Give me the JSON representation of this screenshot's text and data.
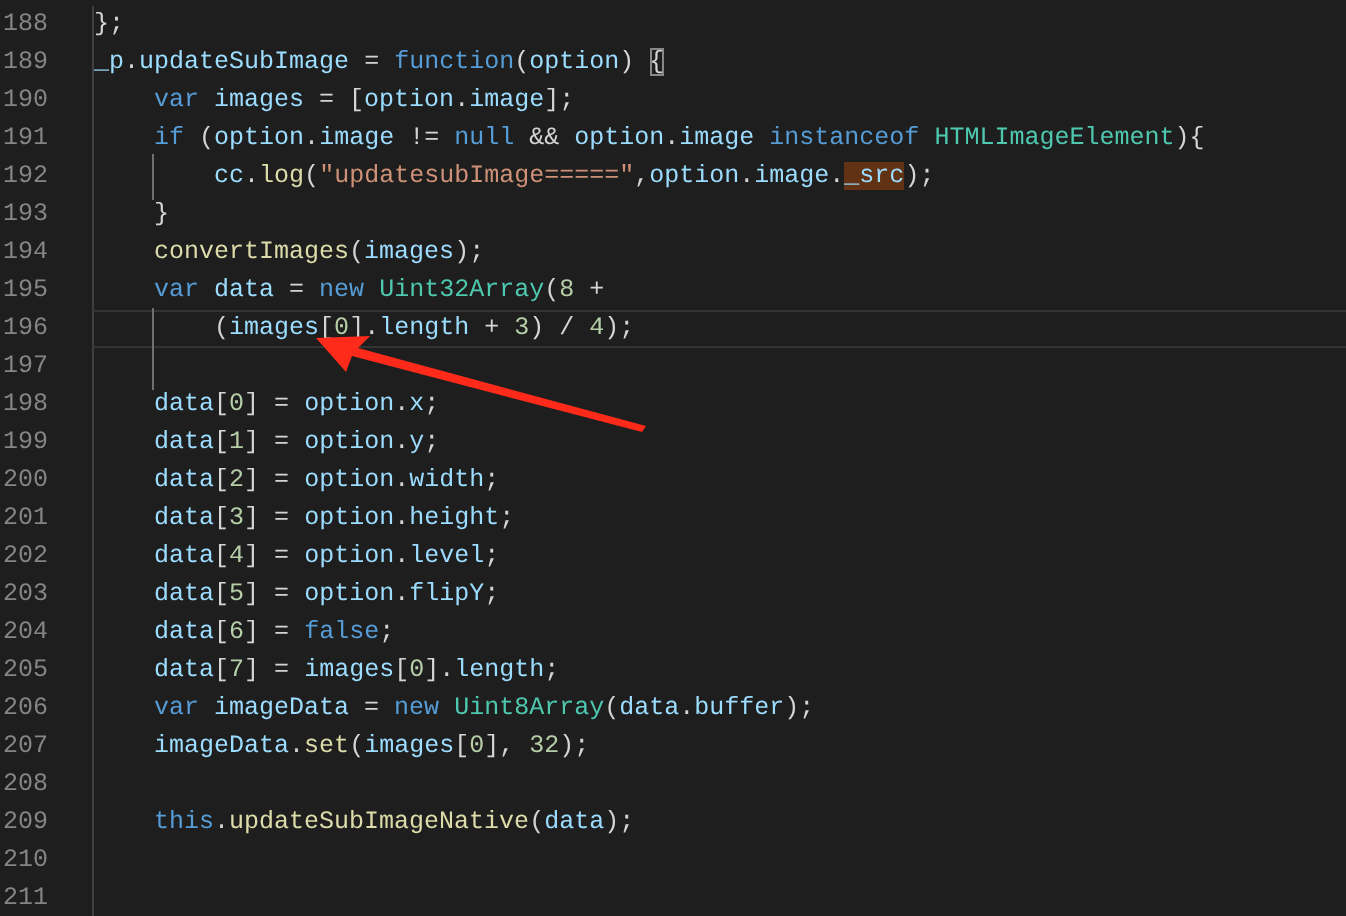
{
  "editor": {
    "lines": [
      {
        "number": "188",
        "current": false,
        "tokens": [
          {
            "text": "};",
            "kind": "punct"
          }
        ]
      },
      {
        "number": "189",
        "current": false,
        "tokens": [
          {
            "text": "_p",
            "kind": "var"
          },
          {
            "text": ".",
            "kind": "punct"
          },
          {
            "text": "updateSubImage",
            "kind": "var"
          },
          {
            "text": " = ",
            "kind": "punct"
          },
          {
            "text": "function",
            "kind": "keyword"
          },
          {
            "text": "(",
            "kind": "punct"
          },
          {
            "text": "option",
            "kind": "var"
          },
          {
            "text": ") ",
            "kind": "punct"
          },
          {
            "text": "{",
            "kind": "matched-bracket"
          }
        ]
      },
      {
        "number": "190",
        "current": false,
        "tokens": [
          {
            "text": "    var ",
            "kind": "keyword"
          },
          {
            "text": "images",
            "kind": "var"
          },
          {
            "text": " = [",
            "kind": "punct"
          },
          {
            "text": "option",
            "kind": "var"
          },
          {
            "text": ".",
            "kind": "punct"
          },
          {
            "text": "image",
            "kind": "var"
          },
          {
            "text": "];",
            "kind": "punct"
          }
        ]
      },
      {
        "number": "191",
        "current": false,
        "tokens": [
          {
            "text": "    if",
            "kind": "keyword"
          },
          {
            "text": " (",
            "kind": "punct"
          },
          {
            "text": "option",
            "kind": "var"
          },
          {
            "text": ".",
            "kind": "punct"
          },
          {
            "text": "image",
            "kind": "var"
          },
          {
            "text": " != ",
            "kind": "punct"
          },
          {
            "text": "null",
            "kind": "keyword"
          },
          {
            "text": " && ",
            "kind": "punct"
          },
          {
            "text": "option",
            "kind": "var"
          },
          {
            "text": ".",
            "kind": "punct"
          },
          {
            "text": "image",
            "kind": "var"
          },
          {
            "text": " instanceof ",
            "kind": "keyword"
          },
          {
            "text": "HTMLImageElement",
            "kind": "type"
          },
          {
            "text": "){",
            "kind": "punct"
          }
        ]
      },
      {
        "number": "192",
        "current": false,
        "tokens": [
          {
            "text": "        cc",
            "kind": "var"
          },
          {
            "text": ".",
            "kind": "punct"
          },
          {
            "text": "log",
            "kind": "function"
          },
          {
            "text": "(",
            "kind": "punct"
          },
          {
            "text": "\"updatesubImage=====\"",
            "kind": "string"
          },
          {
            "text": ",",
            "kind": "punct"
          },
          {
            "text": "option",
            "kind": "var"
          },
          {
            "text": ".",
            "kind": "punct"
          },
          {
            "text": "image",
            "kind": "var"
          },
          {
            "text": ".",
            "kind": "punct"
          },
          {
            "text": "_src",
            "kind": "highlighted-word"
          },
          {
            "text": ");",
            "kind": "punct"
          }
        ]
      },
      {
        "number": "193",
        "current": false,
        "tokens": [
          {
            "text": "    }",
            "kind": "punct"
          }
        ]
      },
      {
        "number": "194",
        "current": false,
        "tokens": [
          {
            "text": "    convertImages",
            "kind": "function"
          },
          {
            "text": "(",
            "kind": "punct"
          },
          {
            "text": "images",
            "kind": "var"
          },
          {
            "text": ");",
            "kind": "punct"
          }
        ]
      },
      {
        "number": "195",
        "current": false,
        "tokens": [
          {
            "text": "    var ",
            "kind": "keyword"
          },
          {
            "text": "data",
            "kind": "var"
          },
          {
            "text": " = ",
            "kind": "punct"
          },
          {
            "text": "new ",
            "kind": "keyword"
          },
          {
            "text": "Uint32Array",
            "kind": "type"
          },
          {
            "text": "(",
            "kind": "punct"
          },
          {
            "text": "8",
            "kind": "number"
          },
          {
            "text": " +",
            "kind": "punct"
          }
        ]
      },
      {
        "number": "196",
        "current": true,
        "tokens": [
          {
            "text": "        (",
            "kind": "punct"
          },
          {
            "text": "images",
            "kind": "var"
          },
          {
            "text": "[",
            "kind": "punct"
          },
          {
            "text": "0",
            "kind": "number"
          },
          {
            "text": "].",
            "kind": "punct"
          },
          {
            "text": "length",
            "kind": "var"
          },
          {
            "text": " + ",
            "kind": "punct"
          },
          {
            "text": "3",
            "kind": "number"
          },
          {
            "text": ") / ",
            "kind": "punct"
          },
          {
            "text": "4",
            "kind": "number"
          },
          {
            "text": ");",
            "kind": "punct"
          }
        ]
      },
      {
        "number": "197",
        "current": false
      },
      {
        "number": "198",
        "current": false,
        "tokens": [
          {
            "text": "    data",
            "kind": "var"
          },
          {
            "text": "[",
            "kind": "punct"
          },
          {
            "text": "0",
            "kind": "number"
          },
          {
            "text": "] = ",
            "kind": "punct"
          },
          {
            "text": "option",
            "kind": "var"
          },
          {
            "text": ".",
            "kind": "punct"
          },
          {
            "text": "x",
            "kind": "var"
          },
          {
            "text": ";",
            "kind": "punct"
          }
        ]
      },
      {
        "number": "199",
        "current": false,
        "tokens": [
          {
            "text": "    data",
            "kind": "var"
          },
          {
            "text": "[",
            "kind": "punct"
          },
          {
            "text": "1",
            "kind": "number"
          },
          {
            "text": "] = ",
            "kind": "punct"
          },
          {
            "text": "option",
            "kind": "var"
          },
          {
            "text": ".",
            "kind": "punct"
          },
          {
            "text": "y",
            "kind": "var"
          },
          {
            "text": ";",
            "kind": "punct"
          }
        ]
      },
      {
        "number": "200",
        "current": false,
        "tokens": [
          {
            "text": "    data",
            "kind": "var"
          },
          {
            "text": "[",
            "kind": "punct"
          },
          {
            "text": "2",
            "kind": "number"
          },
          {
            "text": "] = ",
            "kind": "punct"
          },
          {
            "text": "option",
            "kind": "var"
          },
          {
            "text": ".",
            "kind": "punct"
          },
          {
            "text": "width",
            "kind": "var"
          },
          {
            "text": ";",
            "kind": "punct"
          }
        ]
      },
      {
        "number": "201",
        "current": false,
        "tokens": [
          {
            "text": "    data",
            "kind": "var"
          },
          {
            "text": "[",
            "kind": "punct"
          },
          {
            "text": "3",
            "kind": "number"
          },
          {
            "text": "] = ",
            "kind": "punct"
          },
          {
            "text": "option",
            "kind": "var"
          },
          {
            "text": ".",
            "kind": "punct"
          },
          {
            "text": "height",
            "kind": "var"
          },
          {
            "text": ";",
            "kind": "punct"
          }
        ]
      },
      {
        "number": "202",
        "current": false,
        "tokens": [
          {
            "text": "    data",
            "kind": "var"
          },
          {
            "text": "[",
            "kind": "punct"
          },
          {
            "text": "4",
            "kind": "number"
          },
          {
            "text": "] = ",
            "kind": "punct"
          },
          {
            "text": "option",
            "kind": "var"
          },
          {
            "text": ".",
            "kind": "punct"
          },
          {
            "text": "level",
            "kind": "var"
          },
          {
            "text": ";",
            "kind": "punct"
          }
        ]
      },
      {
        "number": "203",
        "current": false,
        "tokens": [
          {
            "text": "    data",
            "kind": "var"
          },
          {
            "text": "[",
            "kind": "punct"
          },
          {
            "text": "5",
            "kind": "number"
          },
          {
            "text": "] = ",
            "kind": "punct"
          },
          {
            "text": "option",
            "kind": "var"
          },
          {
            "text": ".",
            "kind": "punct"
          },
          {
            "text": "flipY",
            "kind": "var"
          },
          {
            "text": ";",
            "kind": "punct"
          }
        ]
      },
      {
        "number": "204",
        "current": false,
        "tokens": [
          {
            "text": "    data",
            "kind": "var"
          },
          {
            "text": "[",
            "kind": "punct"
          },
          {
            "text": "6",
            "kind": "number"
          },
          {
            "text": "] = ",
            "kind": "punct"
          },
          {
            "text": "false",
            "kind": "keyword"
          },
          {
            "text": ";",
            "kind": "punct"
          }
        ]
      },
      {
        "number": "205",
        "current": false,
        "tokens": [
          {
            "text": "    data",
            "kind": "var"
          },
          {
            "text": "[",
            "kind": "punct"
          },
          {
            "text": "7",
            "kind": "number"
          },
          {
            "text": "] = ",
            "kind": "punct"
          },
          {
            "text": "images",
            "kind": "var"
          },
          {
            "text": "[",
            "kind": "punct"
          },
          {
            "text": "0",
            "kind": "number"
          },
          {
            "text": "].",
            "kind": "punct"
          },
          {
            "text": "length",
            "kind": "var"
          },
          {
            "text": ";",
            "kind": "punct"
          }
        ]
      },
      {
        "number": "206",
        "current": false,
        "tokens": [
          {
            "text": "    var ",
            "kind": "keyword"
          },
          {
            "text": "imageData",
            "kind": "var"
          },
          {
            "text": " = ",
            "kind": "punct"
          },
          {
            "text": "new ",
            "kind": "keyword"
          },
          {
            "text": "Uint8Array",
            "kind": "type"
          },
          {
            "text": "(",
            "kind": "punct"
          },
          {
            "text": "data",
            "kind": "var"
          },
          {
            "text": ".",
            "kind": "punct"
          },
          {
            "text": "buffer",
            "kind": "var"
          },
          {
            "text": ");",
            "kind": "punct"
          }
        ]
      },
      {
        "number": "207",
        "current": false,
        "tokens": [
          {
            "text": "    imageData",
            "kind": "var"
          },
          {
            "text": ".",
            "kind": "punct"
          },
          {
            "text": "set",
            "kind": "function"
          },
          {
            "text": "(",
            "kind": "punct"
          },
          {
            "text": "images",
            "kind": "var"
          },
          {
            "text": "[",
            "kind": "punct"
          },
          {
            "text": "0",
            "kind": "number"
          },
          {
            "text": "], ",
            "kind": "punct"
          },
          {
            "text": "32",
            "kind": "number"
          },
          {
            "text": ");",
            "kind": "punct"
          }
        ]
      },
      {
        "number": "208",
        "current": false
      },
      {
        "number": "209",
        "current": false,
        "tokens": [
          {
            "text": "    this",
            "kind": "keyword"
          },
          {
            "text": ".",
            "kind": "punct"
          },
          {
            "text": "updateSubImageNative",
            "kind": "function"
          },
          {
            "text": "(",
            "kind": "punct"
          },
          {
            "text": "data",
            "kind": "var"
          },
          {
            "text": ");",
            "kind": "punct"
          }
        ]
      },
      {
        "number": "210",
        "current": false
      },
      {
        "number": "211",
        "current": false
      }
    ]
  }
}
